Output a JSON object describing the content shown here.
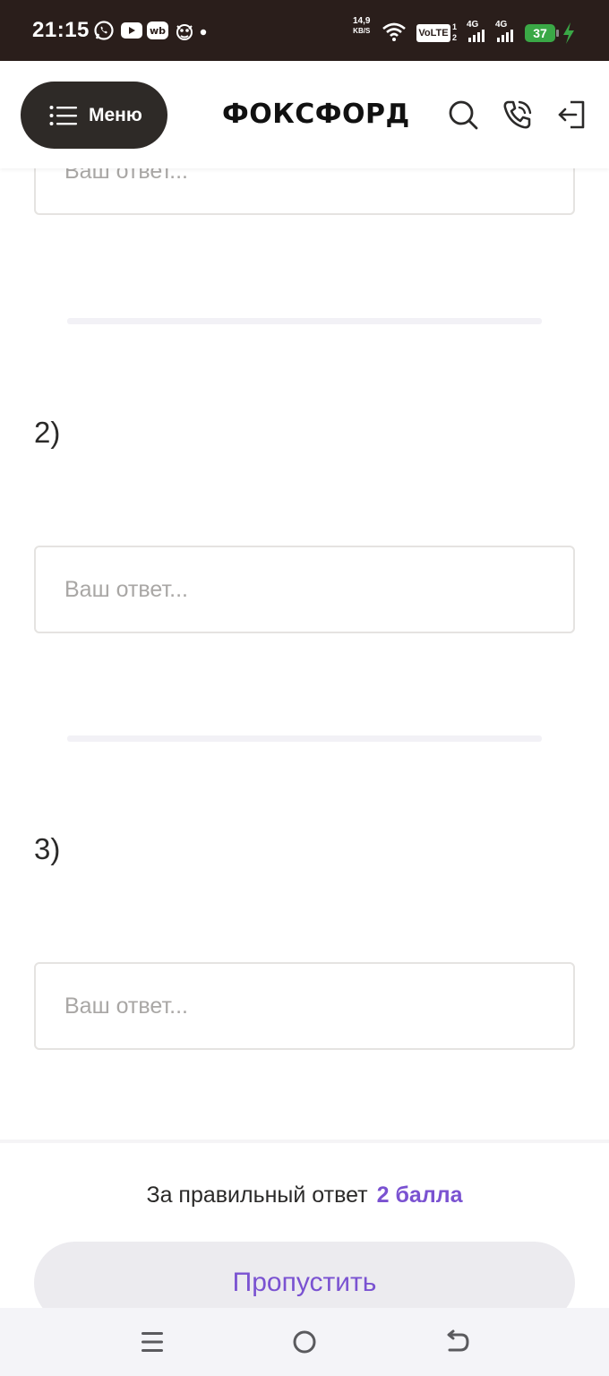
{
  "status_bar": {
    "time": "21:15",
    "net_speed_value": "14,9",
    "net_speed_unit": "KB/S",
    "volte": "VoLTE",
    "sim1_label": "4G",
    "sim2_label": "4G",
    "battery_level": "37",
    "icons": [
      "whatsapp-icon",
      "youtube-icon",
      "wb-icon",
      "game-icon",
      "dot-icon",
      "wifi-icon",
      "signal-icon",
      "charging-icon"
    ]
  },
  "header": {
    "menu_label": "Меню",
    "logo_text": "ФОКСФОРД",
    "icons": [
      "search-icon",
      "phone-icon",
      "login-icon"
    ]
  },
  "questions": [
    {
      "label": "",
      "placeholder": "Ваш ответ..."
    },
    {
      "label": "2)",
      "placeholder": "Ваш ответ..."
    },
    {
      "label": "3)",
      "placeholder": "Ваш ответ..."
    }
  ],
  "footer": {
    "points_text": "За правильный ответ",
    "points_value": "2 балла",
    "skip_label": "Пропустить"
  },
  "colors": {
    "accent": "#7a52d1",
    "dark": "#2e2a27",
    "status_bar": "#2a1e1b",
    "battery": "#3aa846"
  },
  "nav_bar": {
    "icons": [
      "recents-icon",
      "home-icon",
      "back-icon"
    ]
  }
}
